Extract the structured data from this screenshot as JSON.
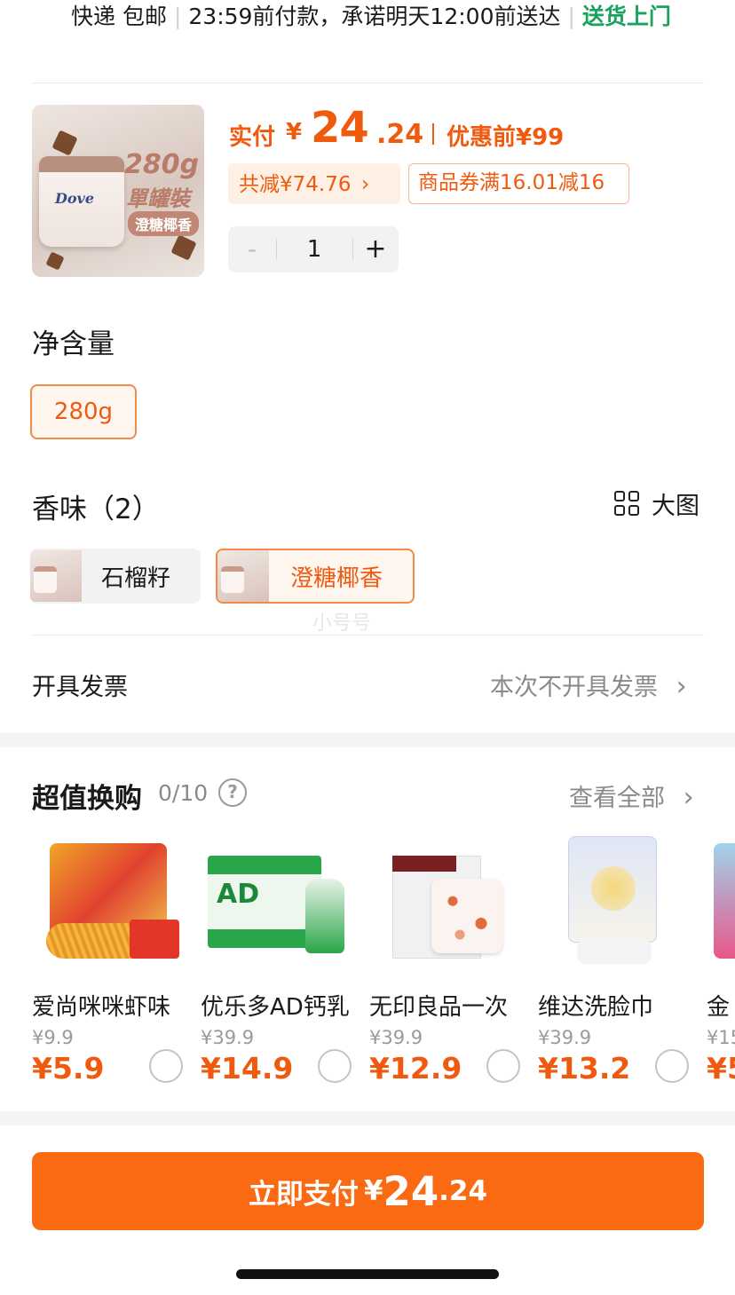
{
  "delivery": {
    "line1_a": "快递 包邮",
    "line1_b": "23:59前付款，承诺明天12:00前送达",
    "green": "送货上门"
  },
  "product": {
    "image_text_1": "280g",
    "image_text_2": "單罐裝",
    "image_text_3": "澄糖椰香",
    "image_brand": "Dove",
    "pay_label": "实付",
    "yen": "¥",
    "price_int": "24",
    "price_dec": ".24",
    "before_label": "优惠前¥99",
    "save_text": "共减¥74.76",
    "coupon_text": "商品券满16.01减16",
    "stepper_minus": "-",
    "quantity": "1",
    "stepper_plus": "+"
  },
  "net_content": {
    "title": "净含量",
    "selected": "280g"
  },
  "flavor": {
    "title": "香味（2）",
    "big_image_label": "大图",
    "options": [
      "石榴籽",
      "澄糖椰香"
    ],
    "selected_index": 1,
    "watermark": "小号号"
  },
  "invoice": {
    "label": "开具发票",
    "value": "本次不开具发票",
    "chevron": "›"
  },
  "swap": {
    "title": "超值换购",
    "count": "0/10",
    "help": "?",
    "view_all": "查看全部",
    "chevron": "›",
    "items": [
      {
        "name": "爱尚咪咪虾味",
        "orig": "¥9.9",
        "now": "¥5.9"
      },
      {
        "name": "优乐多AD钙乳",
        "orig": "¥39.9",
        "now": "¥14.9"
      },
      {
        "name": "无印良品一次",
        "orig": "¥39.9",
        "now": "¥12.9"
      },
      {
        "name": "维达洗脸巾",
        "orig": "¥39.9",
        "now": "¥13.2"
      },
      {
        "name": "金",
        "orig": "¥15",
        "now": "¥5"
      }
    ]
  },
  "checkout": {
    "label": "立即支付",
    "yen": "¥",
    "price_int": "24",
    "price_dec": ".24"
  },
  "colors": {
    "accent": "#f05a0f",
    "button": "#fa6a12",
    "green": "#1aa35d"
  }
}
